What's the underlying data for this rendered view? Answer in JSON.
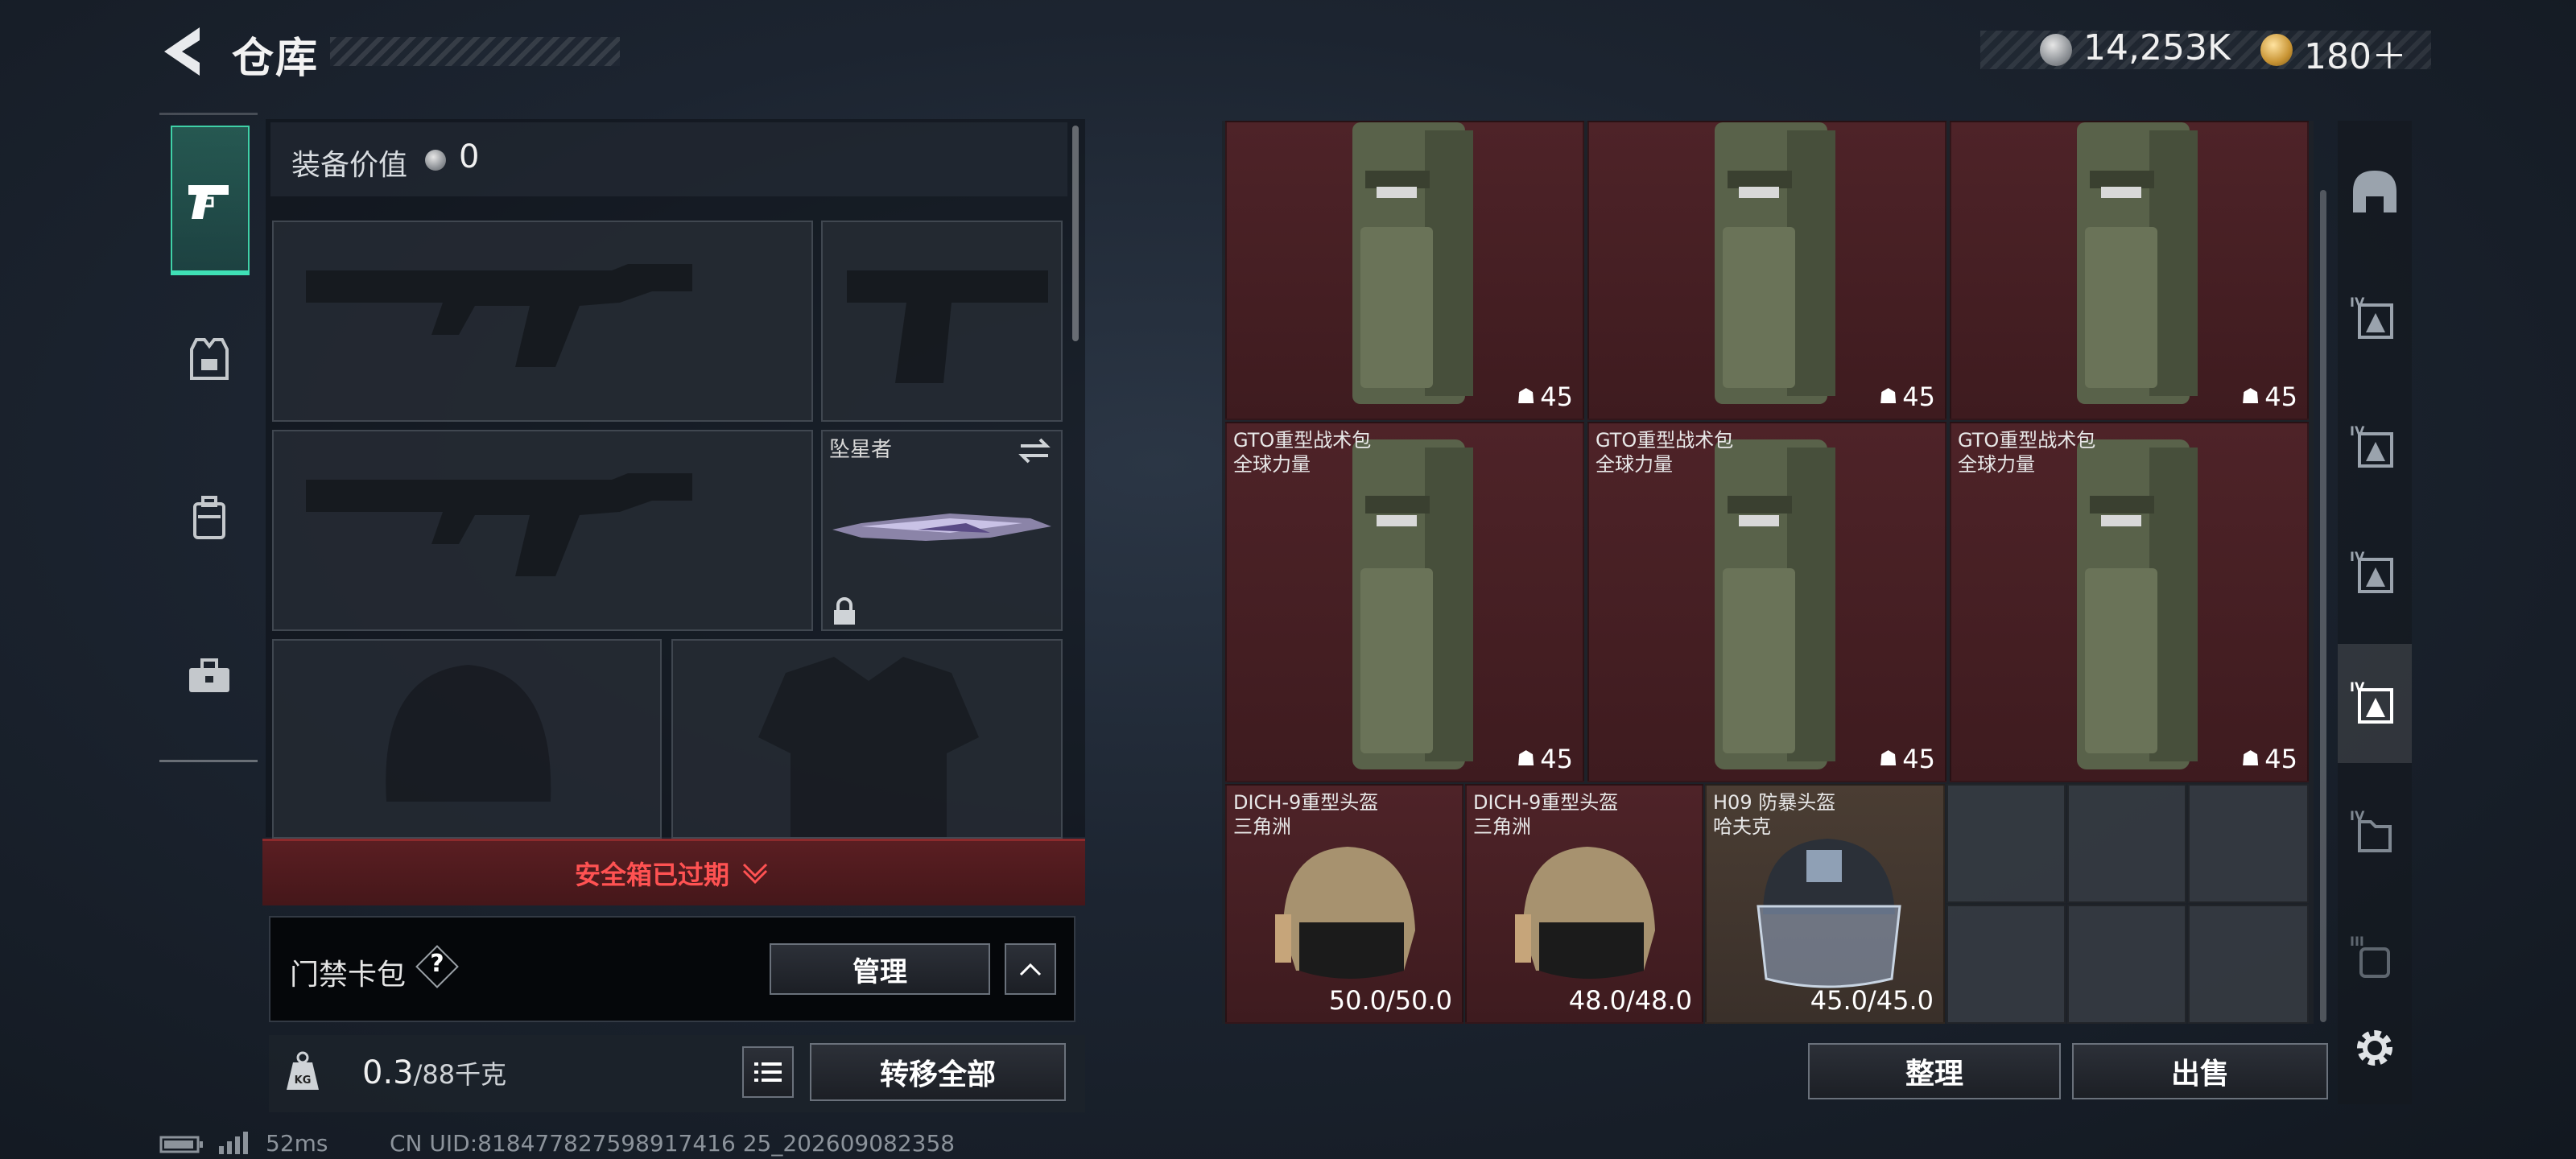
{
  "header": {
    "title": "仓库",
    "currency_silver": "14,253K",
    "currency_gold": "180＋"
  },
  "nav": {
    "items": [
      {
        "name": "gun-icon",
        "active": true
      },
      {
        "name": "vest-icon",
        "active": false
      },
      {
        "name": "backpack-icon",
        "active": false
      },
      {
        "name": "toolbox-icon",
        "active": false
      }
    ]
  },
  "equipment": {
    "value_label": "装备价值",
    "value": "0",
    "melee_name": "坠星者",
    "safebox_status": "安全箱已过期",
    "card_pack_label": "门禁卡包",
    "help": "?",
    "manage_label": "管理",
    "weight_value": "0.3",
    "weight_capacity": "/88千克",
    "transfer_all_label": "转移全部"
  },
  "storage": {
    "backpacks": [
      {
        "name": "",
        "count": "45"
      },
      {
        "name": "",
        "count": "45"
      },
      {
        "name": "",
        "count": "45"
      },
      {
        "name": "GTO重型战术包\n全球力量",
        "count": "45"
      },
      {
        "name": "GTO重型战术包\n全球力量",
        "count": "45"
      },
      {
        "name": "GTO重型战术包\n全球力量",
        "count": "45"
      }
    ],
    "helmets": [
      {
        "name": "DICH-9重型头盔\n三角洲",
        "durability": "50.0/50.0"
      },
      {
        "name": "DICH-9重型头盔\n三角洲",
        "durability": "48.0/48.0"
      },
      {
        "name": "H09 防暴头盔\n哈夫克",
        "durability": "45.0/45.0"
      }
    ],
    "sort_label": "整理",
    "sell_label": "出售"
  },
  "filters": {
    "items": [
      "helmet-icon",
      "tier-iv-helmet-icon",
      "tier-iv-helmet-icon",
      "tier-iv-helmet-icon",
      "tier-iv-helmet-icon",
      "tier-iv-rig-icon",
      "tier-iii-backpack-icon"
    ],
    "active_index": 4
  },
  "footer": {
    "ping": "52ms",
    "uid": "CN UID:818477827598917416 25_202609082358"
  },
  "colors": {
    "accent": "#3fd1a7",
    "danger": "#ff5252",
    "item_red": "#4e2328"
  }
}
